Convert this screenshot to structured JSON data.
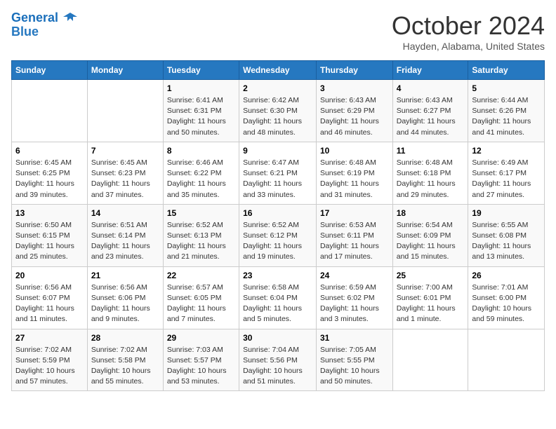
{
  "logo": {
    "line1": "General",
    "line2": "Blue"
  },
  "title": "October 2024",
  "location": "Hayden, Alabama, United States",
  "weekdays": [
    "Sunday",
    "Monday",
    "Tuesday",
    "Wednesday",
    "Thursday",
    "Friday",
    "Saturday"
  ],
  "weeks": [
    [
      {
        "day": "",
        "info": ""
      },
      {
        "day": "",
        "info": ""
      },
      {
        "day": "1",
        "info": "Sunrise: 6:41 AM\nSunset: 6:31 PM\nDaylight: 11 hours and 50 minutes."
      },
      {
        "day": "2",
        "info": "Sunrise: 6:42 AM\nSunset: 6:30 PM\nDaylight: 11 hours and 48 minutes."
      },
      {
        "day": "3",
        "info": "Sunrise: 6:43 AM\nSunset: 6:29 PM\nDaylight: 11 hours and 46 minutes."
      },
      {
        "day": "4",
        "info": "Sunrise: 6:43 AM\nSunset: 6:27 PM\nDaylight: 11 hours and 44 minutes."
      },
      {
        "day": "5",
        "info": "Sunrise: 6:44 AM\nSunset: 6:26 PM\nDaylight: 11 hours and 41 minutes."
      }
    ],
    [
      {
        "day": "6",
        "info": "Sunrise: 6:45 AM\nSunset: 6:25 PM\nDaylight: 11 hours and 39 minutes."
      },
      {
        "day": "7",
        "info": "Sunrise: 6:45 AM\nSunset: 6:23 PM\nDaylight: 11 hours and 37 minutes."
      },
      {
        "day": "8",
        "info": "Sunrise: 6:46 AM\nSunset: 6:22 PM\nDaylight: 11 hours and 35 minutes."
      },
      {
        "day": "9",
        "info": "Sunrise: 6:47 AM\nSunset: 6:21 PM\nDaylight: 11 hours and 33 minutes."
      },
      {
        "day": "10",
        "info": "Sunrise: 6:48 AM\nSunset: 6:19 PM\nDaylight: 11 hours and 31 minutes."
      },
      {
        "day": "11",
        "info": "Sunrise: 6:48 AM\nSunset: 6:18 PM\nDaylight: 11 hours and 29 minutes."
      },
      {
        "day": "12",
        "info": "Sunrise: 6:49 AM\nSunset: 6:17 PM\nDaylight: 11 hours and 27 minutes."
      }
    ],
    [
      {
        "day": "13",
        "info": "Sunrise: 6:50 AM\nSunset: 6:15 PM\nDaylight: 11 hours and 25 minutes."
      },
      {
        "day": "14",
        "info": "Sunrise: 6:51 AM\nSunset: 6:14 PM\nDaylight: 11 hours and 23 minutes."
      },
      {
        "day": "15",
        "info": "Sunrise: 6:52 AM\nSunset: 6:13 PM\nDaylight: 11 hours and 21 minutes."
      },
      {
        "day": "16",
        "info": "Sunrise: 6:52 AM\nSunset: 6:12 PM\nDaylight: 11 hours and 19 minutes."
      },
      {
        "day": "17",
        "info": "Sunrise: 6:53 AM\nSunset: 6:11 PM\nDaylight: 11 hours and 17 minutes."
      },
      {
        "day": "18",
        "info": "Sunrise: 6:54 AM\nSunset: 6:09 PM\nDaylight: 11 hours and 15 minutes."
      },
      {
        "day": "19",
        "info": "Sunrise: 6:55 AM\nSunset: 6:08 PM\nDaylight: 11 hours and 13 minutes."
      }
    ],
    [
      {
        "day": "20",
        "info": "Sunrise: 6:56 AM\nSunset: 6:07 PM\nDaylight: 11 hours and 11 minutes."
      },
      {
        "day": "21",
        "info": "Sunrise: 6:56 AM\nSunset: 6:06 PM\nDaylight: 11 hours and 9 minutes."
      },
      {
        "day": "22",
        "info": "Sunrise: 6:57 AM\nSunset: 6:05 PM\nDaylight: 11 hours and 7 minutes."
      },
      {
        "day": "23",
        "info": "Sunrise: 6:58 AM\nSunset: 6:04 PM\nDaylight: 11 hours and 5 minutes."
      },
      {
        "day": "24",
        "info": "Sunrise: 6:59 AM\nSunset: 6:02 PM\nDaylight: 11 hours and 3 minutes."
      },
      {
        "day": "25",
        "info": "Sunrise: 7:00 AM\nSunset: 6:01 PM\nDaylight: 11 hours and 1 minute."
      },
      {
        "day": "26",
        "info": "Sunrise: 7:01 AM\nSunset: 6:00 PM\nDaylight: 10 hours and 59 minutes."
      }
    ],
    [
      {
        "day": "27",
        "info": "Sunrise: 7:02 AM\nSunset: 5:59 PM\nDaylight: 10 hours and 57 minutes."
      },
      {
        "day": "28",
        "info": "Sunrise: 7:02 AM\nSunset: 5:58 PM\nDaylight: 10 hours and 55 minutes."
      },
      {
        "day": "29",
        "info": "Sunrise: 7:03 AM\nSunset: 5:57 PM\nDaylight: 10 hours and 53 minutes."
      },
      {
        "day": "30",
        "info": "Sunrise: 7:04 AM\nSunset: 5:56 PM\nDaylight: 10 hours and 51 minutes."
      },
      {
        "day": "31",
        "info": "Sunrise: 7:05 AM\nSunset: 5:55 PM\nDaylight: 10 hours and 50 minutes."
      },
      {
        "day": "",
        "info": ""
      },
      {
        "day": "",
        "info": ""
      }
    ]
  ]
}
